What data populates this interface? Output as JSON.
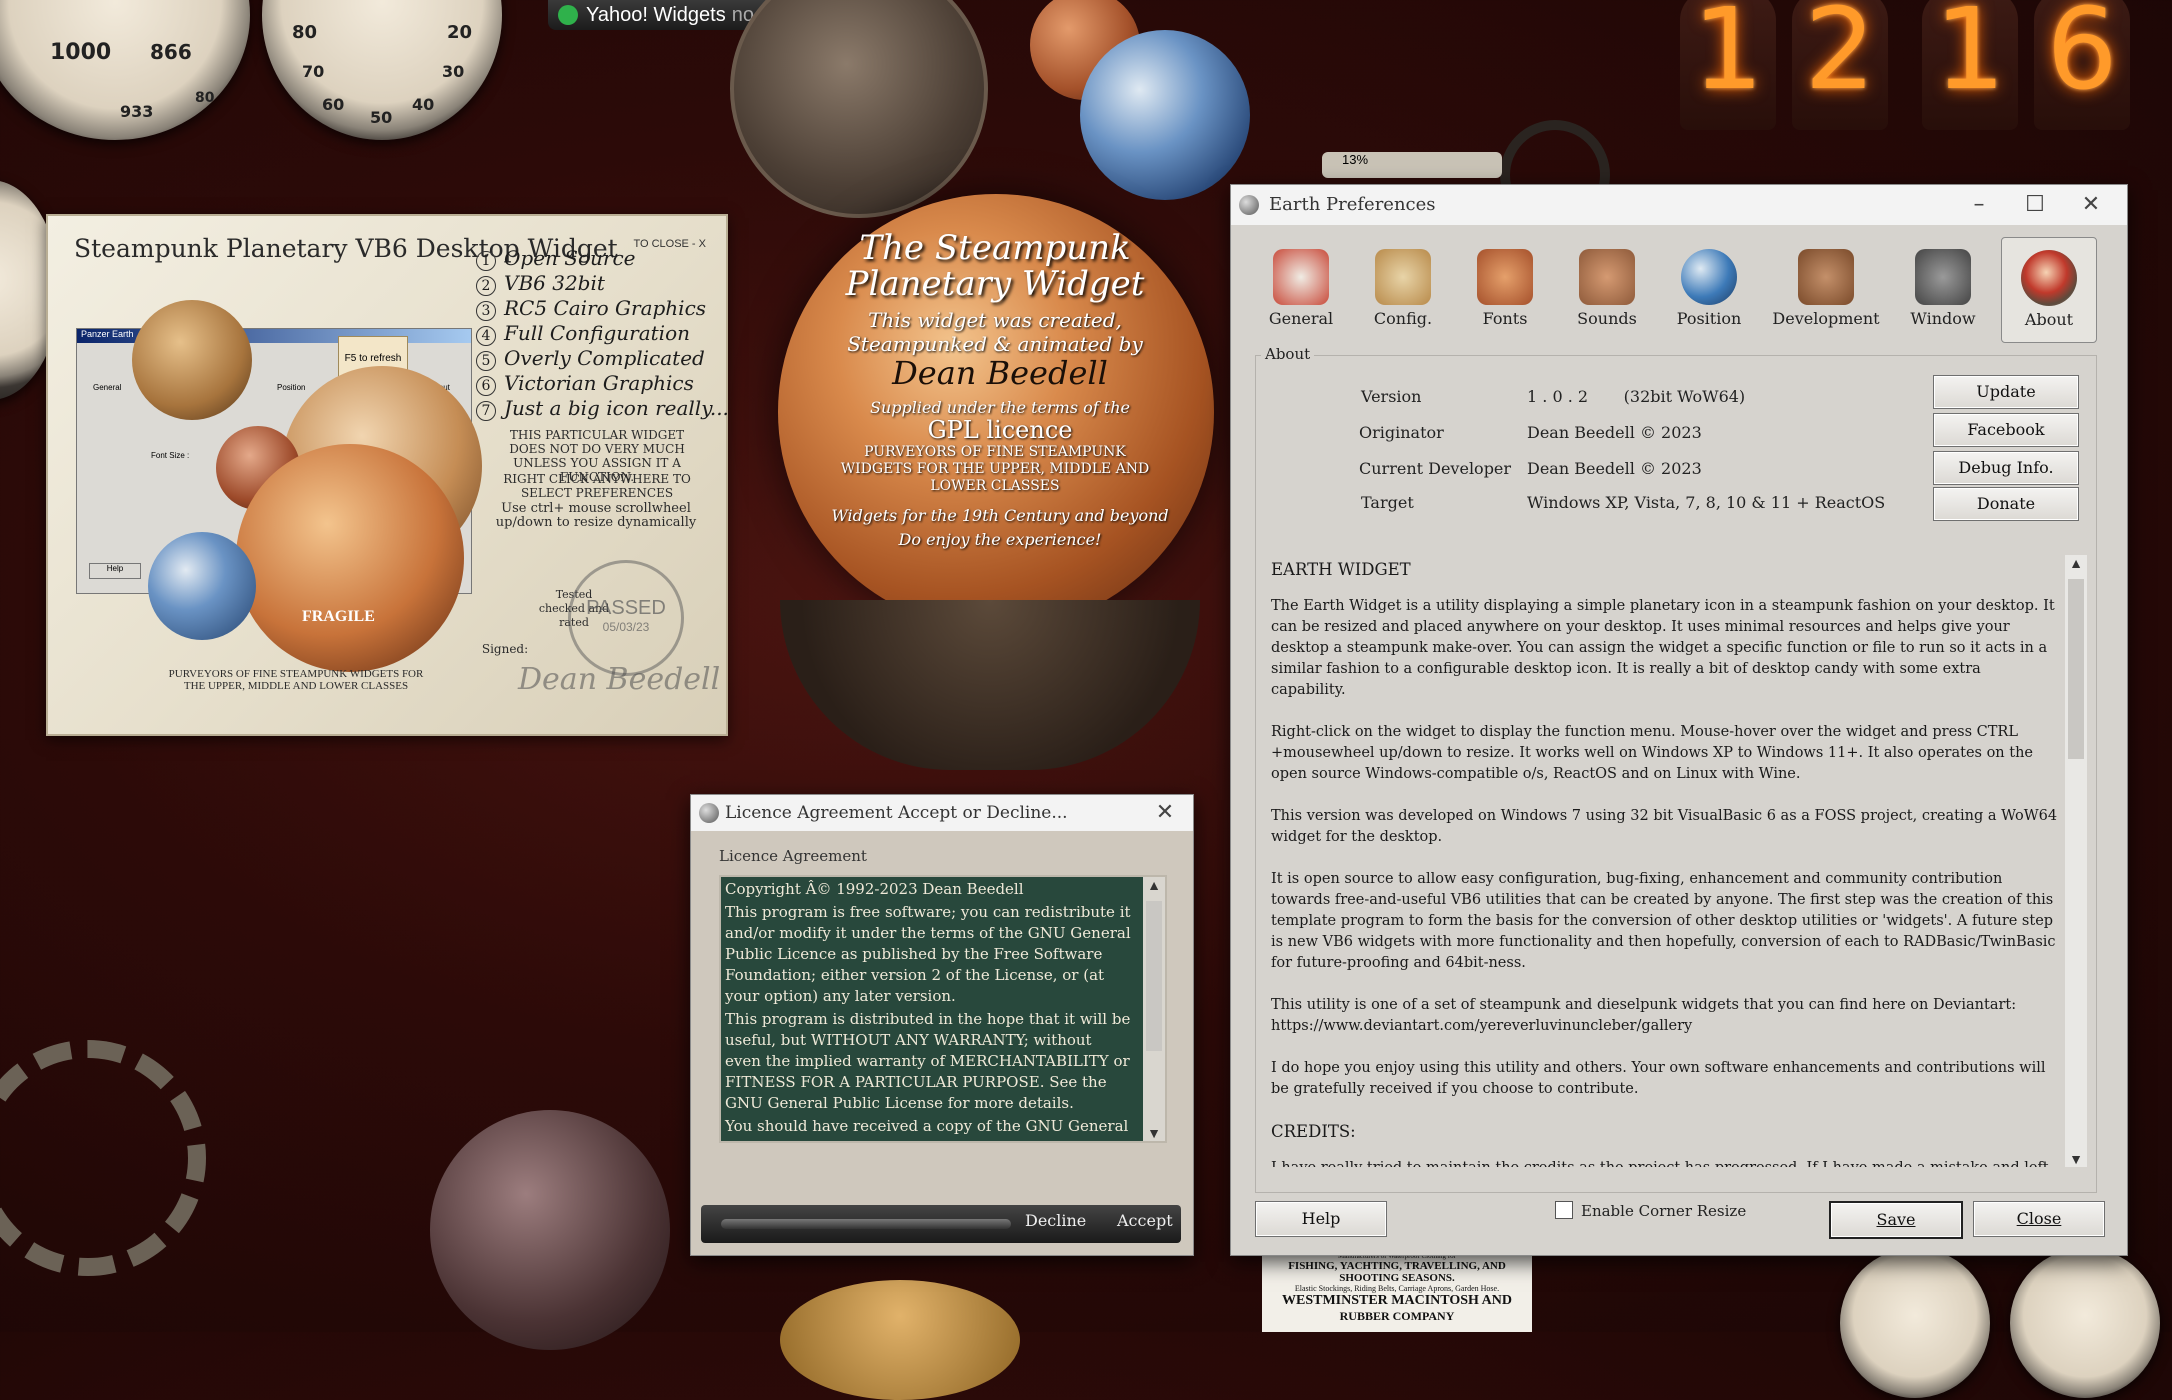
{
  "desktop": {
    "yahoo_widget": {
      "label": "Yahoo! Widgets",
      "status": "no data"
    },
    "gauge1": {
      "readouts": [
        "1000",
        "866",
        "933",
        "80"
      ]
    },
    "gauge2": {
      "readouts": [
        "80",
        "20",
        "70",
        "30",
        "60",
        "50",
        "40"
      ]
    },
    "nixie_digits": [
      "1",
      "2",
      "1",
      "6"
    ],
    "cpu_percent": "13%",
    "splash": {
      "title": "The Steampunk Planetary Widget",
      "line1": "This widget was created, Steampunked & animated by",
      "author": "Dean Beedell",
      "line2": "Supplied under the terms of the",
      "licence": "GPL licence",
      "line3": "PURVEYORS OF FINE STEAMPUNK WIDGETS FOR THE UPPER, MIDDLE AND LOWER CLASSES",
      "line4": "Widgets for the 19th Century and beyond",
      "line5": "Do enjoy the experience!"
    }
  },
  "widget_panel": {
    "title": "Steampunk Planetary VB6 Desktop Widget",
    "close_hint": "TO CLOSE - X",
    "features": [
      {
        "n": "1",
        "text": "Open Source"
      },
      {
        "n": "2",
        "text": "VB6 32bit"
      },
      {
        "n": "3",
        "text": "RC5 Cairo Graphics"
      },
      {
        "n": "4",
        "text": "Full Configuration"
      },
      {
        "n": "5",
        "text": "Overly Complicated"
      },
      {
        "n": "6",
        "text": "Victorian Graphics"
      },
      {
        "n": "7",
        "text": "Just a big icon really..."
      }
    ],
    "note1": "THIS PARTICULAR WIDGET DOES NOT DO VERY MUCH UNLESS YOU ASSIGN IT A FUNCTION.",
    "note2": "RIGHT CLICK ANYWHERE TO SELECT PREFERENCES",
    "note3": "Use ctrl+ mouse scrollwheel up/down to resize dynamically",
    "refresh": "F5 to refresh",
    "tested": "Tested checked and rated",
    "stamp": "PASSED",
    "stamp_date": "05/03/23",
    "signed": "Signed:",
    "signature": "Dean Beedell",
    "fragile": "FRAGILE",
    "purveyors": "PURVEYORS OF FINE STEAMPUNK WIDGETS FOR THE UPPER, MIDDLE AND LOWER CLASSES",
    "mini_window": {
      "title": "Panzer Earth",
      "tabs": [
        "General",
        "Position",
        "About"
      ],
      "help": "Help",
      "font_size": "Font Size :"
    }
  },
  "prefs": {
    "title": "Earth Preferences",
    "tabs": [
      {
        "label": "General",
        "icon": "switches-icon",
        "color": "#c84a3a"
      },
      {
        "label": "Config.",
        "icon": "scroll-icon",
        "color": "#b88a4a"
      },
      {
        "label": "Fonts",
        "icon": "quill-icon",
        "color": "#a5502b"
      },
      {
        "label": "Sounds",
        "icon": "speaker-icon",
        "color": "#8e5a3a"
      },
      {
        "label": "Position",
        "icon": "globe-icon",
        "color": "#3d7ab8"
      },
      {
        "label": "Development",
        "icon": "tools-icon",
        "color": "#7a4a2a"
      },
      {
        "label": "Window",
        "icon": "window-icon",
        "color": "#555555"
      },
      {
        "label": "About",
        "icon": "about-icon",
        "color": "#c0392b"
      }
    ],
    "about_legend": "About",
    "rows": [
      {
        "key": "Version",
        "value": "1 . 0 . 2       (32bit WoW64)"
      },
      {
        "key": "Originator",
        "value": "Dean Beedell © 2023"
      },
      {
        "key": "Current Developer",
        "value": "Dean Beedell © 2023"
      },
      {
        "key": "Target",
        "value": "Windows XP, Vista, 7, 8, 10  & 11 + ReactOS"
      }
    ],
    "side_buttons": [
      "Update",
      "Facebook",
      "Debug Info.",
      "Donate"
    ],
    "about_text": {
      "heading": "EARTH WIDGET",
      "p1": "The Earth Widget is a utility displaying a simple planetary icon in a steampunk fashion on your desktop. It can be resized and placed anywhere on your desktop. It uses minimal resources and helps give your desktop a steampunk make-over. You can assign the widget a specific function or file to run so it acts in a similar fashion to a configurable desktop icon. It is really a bit of desktop candy with some extra capability.",
      "p2": "Right-click on the widget to display the function menu. Mouse-hover over the widget and press CTRL +mousewheel up/down to resize. It works well on Windows XP to Windows 11+. It also operates on the open source Windows-compatible o/s, ReactOS and on Linux with Wine.",
      "p3": "This version was developed on Windows 7 using 32 bit VisualBasic 6 as a FOSS project, creating a WoW64 widget for the desktop.",
      "p4": "It is open source to allow easy configuration, bug-fixing, enhancement and community contribution towards free-and-useful VB6 utilities that can be created by anyone. The first step was the creation of this template program to form the basis for the conversion of other desktop utilities or 'widgets'. A future step is new VB6 widgets with more functionality and then hopefully, conversion of each to RADBasic/TwinBasic for future-proofing and 64bit-ness.",
      "p5": "This utility is one of a set of steampunk and dieselpunk widgets that you can find here on Deviantart: https://www.deviantart.com/yereverluvinuncleber/gallery",
      "p6": "I do hope you enjoy using this utility and others. Your own software enhancements and contributions will be gratefully received if you choose to contribute.",
      "credits": "CREDITS:",
      "p7": "I have really tried to maintain the credits as the project has progressed. If I have made a mistake and left"
    },
    "help_button": "Help",
    "corner_resize_label": "Enable Corner Resize",
    "save_button": "Save",
    "close_button": "Close"
  },
  "licence": {
    "title": "Licence Agreement Accept or Decline...",
    "inner_label": "Licence Agreement",
    "text": [
      "Copyright Â© 1992-2023 Dean Beedell",
      "This program is free software; you can redistribute it and/or modify it under the terms of the GNU General Public Licence as published by the Free Software Foundation; either version 2 of the License, or (at your option) any later version.",
      "This program is distributed in the hope that it will be useful, but WITHOUT ANY WARRANTY; without even the implied warranty of MERCHANTABILITY or FITNESS FOR A PARTICULAR PURPOSE.  See the GNU General Public License for more details.",
      "You should have received a copy of the GNU General"
    ],
    "decline": "Decline",
    "accept": "Accept"
  },
  "newspaper": {
    "line1": "Manufacturers of Waterproof Clothing for",
    "line2": "FISHING, YACHTING, TRAVELLING, AND SHOOTING SEASONS.",
    "line3": "Elastic Stockings, Riding Belts, Carriage Aprons, Garden Hose.",
    "line4": "WESTMINSTER  MACINTOSH  AND",
    "line5": "RUBBER COMPANY"
  }
}
